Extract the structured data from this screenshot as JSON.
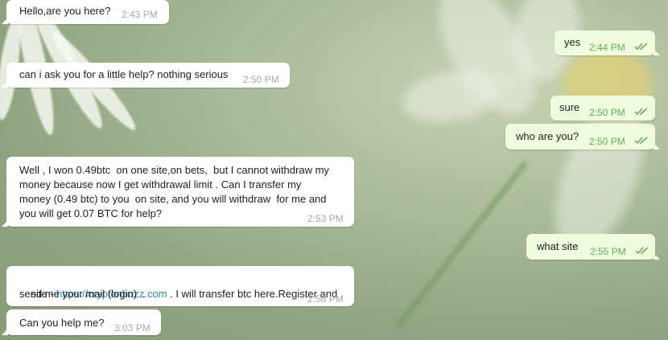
{
  "colors": {
    "incoming_bubble": "#ffffff",
    "outgoing_bubble": "#effdde",
    "outgoing_time": "#62ac55",
    "incoming_time": "#a3a9ad",
    "link": "#2a88c4"
  },
  "messages": [
    {
      "dir": "in",
      "text": "Hello,are you here?",
      "time": "2:43 PM"
    },
    {
      "dir": "out",
      "text": "yes",
      "time": "2:44 PM",
      "status": "read-checks-icon"
    },
    {
      "dir": "in",
      "text": "can i ask you for a little help? nothing serious",
      "time": "2:50 PM"
    },
    {
      "dir": "out",
      "text": "sure",
      "time": "2:50 PM",
      "status": "read-checks-icon"
    },
    {
      "dir": "out",
      "text": "who are you?",
      "time": "2:50 PM",
      "status": "read-checks-icon"
    },
    {
      "dir": "in",
      "lines": [
        "Well , I won 0.49btc  on one site,on bets,  but I cannot withdraw my",
        "money because now I get withdrawal limit . Can I transfer my",
        "money (0.49 btc) to you  on site, and you will withdraw  for me and",
        "you will get 0.07 BTC for help?"
      ],
      "time": "2:53 PM"
    },
    {
      "dir": "out",
      "text": "what site",
      "time": "2:55 PM",
      "status": "read-checks-icon"
    },
    {
      "dir": "in",
      "prefix": "site - ",
      "link": "https://cryptonbuzz.com",
      "suffix": " . I will transfer btc here.Register and",
      "line2": "send me your mail (login)  .",
      "time": "2:56 PM"
    },
    {
      "dir": "in",
      "text": "Can you help me?",
      "time": "3:03 PM"
    }
  ]
}
